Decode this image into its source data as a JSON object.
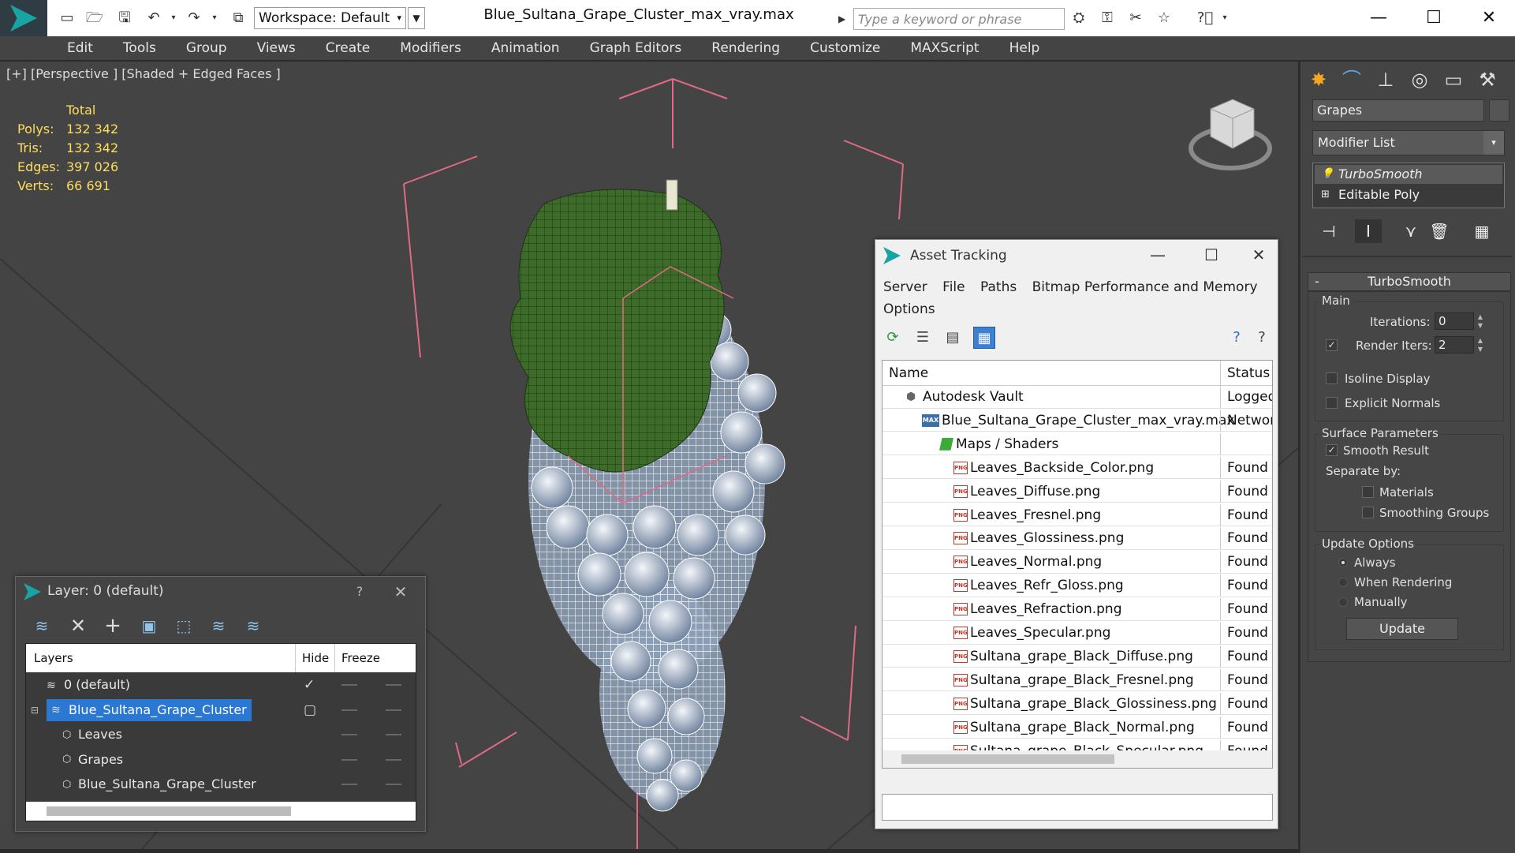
{
  "window": {
    "title": "Blue_Sultana_Grape_Cluster_max_vray.max",
    "workspace_label": "Workspace: Default",
    "search_placeholder": "Type a keyword or phrase"
  },
  "menu": [
    "Edit",
    "Tools",
    "Group",
    "Views",
    "Create",
    "Modifiers",
    "Animation",
    "Graph Editors",
    "Rendering",
    "Customize",
    "MAXScript",
    "Help"
  ],
  "viewport": {
    "label": "[+] [Perspective ] [Shaded + Edged Faces ]",
    "stats": {
      "total_label": "Total",
      "rows": [
        {
          "k": "Polys:",
          "v": "132 342"
        },
        {
          "k": "Tris:",
          "v": "132 342"
        },
        {
          "k": "Edges:",
          "v": "397 026"
        },
        {
          "k": "Verts:",
          "v": "66 691"
        }
      ]
    }
  },
  "command_panel": {
    "object_name": "Grapes",
    "modifier_list": "Modifier List",
    "stack": [
      "TurboSmooth",
      "Editable Poly"
    ],
    "rollout_title": "TurboSmooth",
    "main_label": "Main",
    "iterations_label": "Iterations:",
    "iterations_value": "0",
    "render_iters_label": "Render Iters:",
    "render_iters_value": "2",
    "isoline": "Isoline Display",
    "explicit_normals": "Explicit Normals",
    "surface_params": "Surface Parameters",
    "smooth_result": "Smooth Result",
    "separate_by": "Separate by:",
    "materials": "Materials",
    "smoothing_groups": "Smoothing Groups",
    "update_options": "Update Options",
    "always": "Always",
    "when_rendering": "When Rendering",
    "manually": "Manually",
    "update_button": "Update"
  },
  "asset_tracking": {
    "title": "Asset Tracking",
    "menu": [
      "Server",
      "File",
      "Paths",
      "Bitmap Performance and Memory",
      "Options"
    ],
    "col_name": "Name",
    "col_status": "Status",
    "rows": [
      {
        "name": "Autodesk Vault",
        "status": "Logged",
        "icon": "vault",
        "indent": 30
      },
      {
        "name": "Blue_Sultana_Grape_Cluster_max_vray.max",
        "status": "Networ",
        "icon": "max",
        "indent": 50
      },
      {
        "name": "Maps / Shaders",
        "status": "",
        "icon": "maps",
        "indent": 72
      },
      {
        "name": "Leaves_Backside_Color.png",
        "status": "Found",
        "icon": "png",
        "indent": 90
      },
      {
        "name": "Leaves_Diffuse.png",
        "status": "Found",
        "icon": "png",
        "indent": 90
      },
      {
        "name": "Leaves_Fresnel.png",
        "status": "Found",
        "icon": "png",
        "indent": 90
      },
      {
        "name": "Leaves_Glossiness.png",
        "status": "Found",
        "icon": "png",
        "indent": 90
      },
      {
        "name": "Leaves_Normal.png",
        "status": "Found",
        "icon": "png",
        "indent": 90
      },
      {
        "name": "Leaves_Refr_Gloss.png",
        "status": "Found",
        "icon": "png",
        "indent": 90
      },
      {
        "name": "Leaves_Refraction.png",
        "status": "Found",
        "icon": "png",
        "indent": 90
      },
      {
        "name": "Leaves_Specular.png",
        "status": "Found",
        "icon": "png",
        "indent": 90
      },
      {
        "name": "Sultana_grape_Black_Diffuse.png",
        "status": "Found",
        "icon": "png",
        "indent": 90
      },
      {
        "name": "Sultana_grape_Black_Fresnel.png",
        "status": "Found",
        "icon": "png",
        "indent": 90
      },
      {
        "name": "Sultana_grape_Black_Glossiness.png",
        "status": "Found",
        "icon": "png",
        "indent": 90
      },
      {
        "name": "Sultana_grape_Black_Normal.png",
        "status": "Found",
        "icon": "png",
        "indent": 90
      },
      {
        "name": "Sultana_grape_Black_Specular.png",
        "status": "Found",
        "icon": "png",
        "indent": 90
      }
    ]
  },
  "layer_dialog": {
    "title": "Layer: 0 (default)",
    "help": "?",
    "col_layers": "Layers",
    "col_hide": "Hide",
    "col_freeze": "Freeze",
    "rows": [
      {
        "name": "0 (default)",
        "type": "layer",
        "indent": 26,
        "current": true,
        "selected": false
      },
      {
        "name": "Blue_Sultana_Grape_Cluster",
        "type": "layer",
        "indent": 26,
        "current": false,
        "selected": true
      },
      {
        "name": "Leaves",
        "type": "object",
        "indent": 46,
        "current": false,
        "selected": false
      },
      {
        "name": "Grapes",
        "type": "object",
        "indent": 46,
        "current": false,
        "selected": false
      },
      {
        "name": "Blue_Sultana_Grape_Cluster",
        "type": "object",
        "indent": 46,
        "current": false,
        "selected": false
      }
    ]
  }
}
